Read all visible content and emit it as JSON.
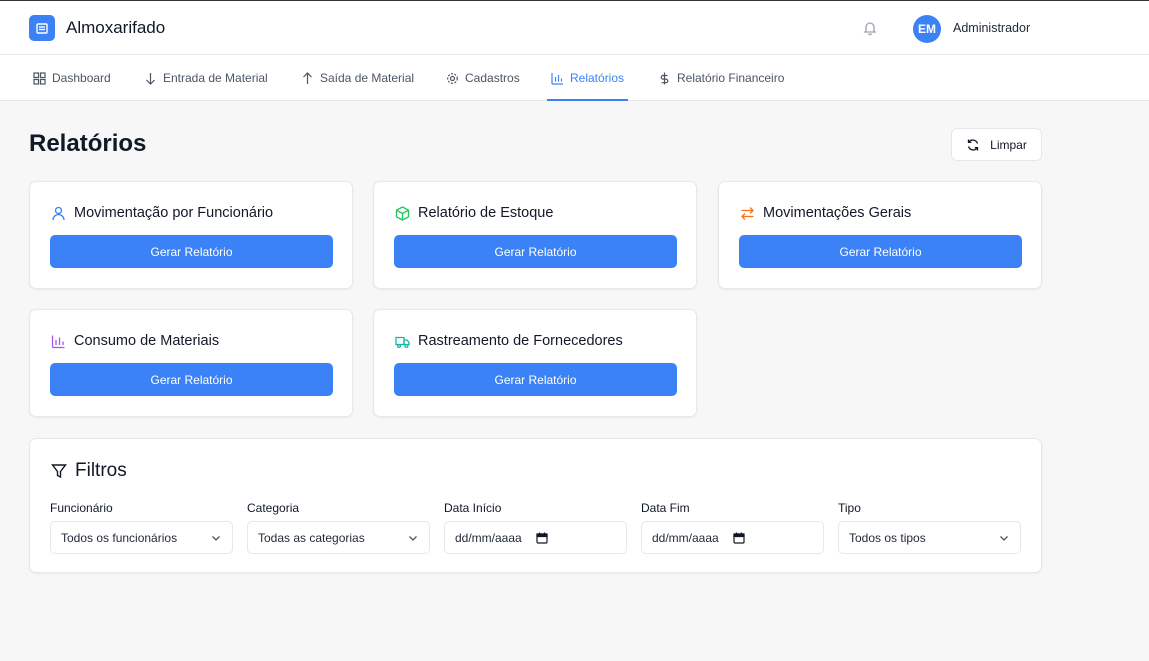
{
  "header": {
    "app_title": "Almoxarifado",
    "user_initials": "EM",
    "user_name": "Administrador"
  },
  "nav": {
    "items": [
      {
        "label": "Dashboard",
        "icon": "grid-icon"
      },
      {
        "label": "Entrada de Material",
        "icon": "arrow-down-icon"
      },
      {
        "label": "Saída de Material",
        "icon": "arrow-up-icon"
      },
      {
        "label": "Cadastros",
        "icon": "gear-icon"
      },
      {
        "label": "Relatórios",
        "icon": "bar-chart-icon",
        "active": true
      },
      {
        "label": "Relatório Financeiro",
        "icon": "dollar-icon"
      }
    ]
  },
  "page": {
    "title": "Relatórios",
    "clear_label": "Limpar"
  },
  "reports": [
    {
      "title": "Movimentação por Funcionário",
      "button": "Gerar Relatório",
      "icon": "user-icon",
      "color": "#3b82f6"
    },
    {
      "title": "Relatório de Estoque",
      "button": "Gerar Relatório",
      "icon": "package-icon",
      "color": "#22c55e"
    },
    {
      "title": "Movimentações Gerais",
      "button": "Gerar Relatório",
      "icon": "swap-arrows-icon",
      "color": "#f97316"
    },
    {
      "title": "Consumo de Materiais",
      "button": "Gerar Relatório",
      "icon": "bar-chart-icon",
      "color": "#a855f7"
    },
    {
      "title": "Rastreamento de Fornecedores",
      "button": "Gerar Relatório",
      "icon": "truck-icon",
      "color": "#14b8a6"
    }
  ],
  "filters": {
    "title": "Filtros",
    "fields": [
      {
        "label": "Funcionário",
        "value": "Todos os funcionários",
        "kind": "select"
      },
      {
        "label": "Categoria",
        "value": "Todas as categorias",
        "kind": "select"
      },
      {
        "label": "Data Início",
        "value": "dd/mm/aaaa",
        "kind": "date"
      },
      {
        "label": "Data Fim",
        "value": "dd/mm/aaaa",
        "kind": "date"
      },
      {
        "label": "Tipo",
        "value": "Todos os tipos",
        "kind": "select"
      }
    ]
  },
  "colors": {
    "accent": "#3b82f6",
    "background": "#f7f7f8"
  }
}
